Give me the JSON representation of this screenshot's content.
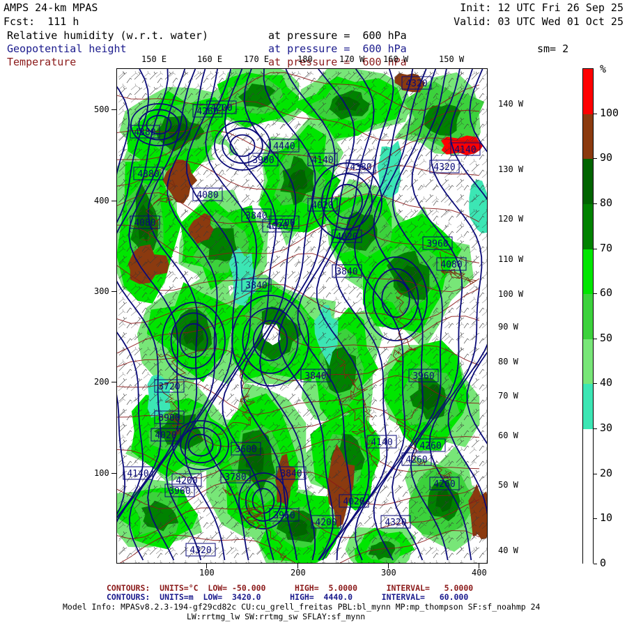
{
  "header": {
    "model_title": "AMPS 24-km MPAS",
    "init": "Init: 12 UTC Fri 26 Sep 25",
    "forecast": "Fcst:  111 h",
    "valid": "Valid: 03 UTC Wed 01 Oct 25",
    "smoothing": "sm= 2",
    "fields": [
      {
        "name": "Relative humidity (w.r.t. water)",
        "level": "at pressure =  600 hPa",
        "color": "#000000"
      },
      {
        "name": "Geopotential height",
        "level": "at pressure =  600 hPa",
        "color": "#1a1a8c"
      },
      {
        "name": "Temperature",
        "level": "at pressure =  600 hPa",
        "color": "#8b1a1a"
      }
    ]
  },
  "map": {
    "top_lon_labels": [
      "150 E",
      "160 E",
      "170 E",
      "180",
      "170 W",
      "160 W",
      "150 W"
    ],
    "right_lon_labels": [
      "140 W",
      "130 W",
      "120 W",
      "110 W",
      "100 W",
      "90 W",
      "80 W",
      "70 W",
      "60 W",
      "50 W",
      "40 W"
    ],
    "y_ticks": [
      "500",
      "400",
      "300",
      "200",
      "100"
    ],
    "x_ticks": [
      "100",
      "200",
      "300",
      "400"
    ],
    "height_contour_labels": [
      "4260",
      "4260",
      "4380",
      "4200",
      "4200",
      "4020",
      "4020",
      "4320",
      "4380",
      "4320",
      "4140",
      "3960",
      "4020",
      "4140",
      "3900",
      "3840",
      "4080",
      "3960",
      "3600",
      "3840",
      "3720",
      "3900",
      "3960",
      "4080",
      "4140",
      "4020",
      "3840",
      "3780",
      "3840",
      "4020",
      "4080",
      "3840",
      "4200",
      "4260",
      "4140",
      "3960",
      "4200",
      "4320",
      "4320",
      "4380",
      "4440",
      "4260"
    ],
    "colors": {
      "height": "#0a0a78",
      "temperature": "#8b1a1a",
      "barb": "#333333"
    }
  },
  "colorbar": {
    "unit": "%",
    "labels": [
      "100",
      "90",
      "80",
      "70",
      "60",
      "50",
      "40",
      "30",
      "20",
      "10",
      "0"
    ],
    "segments": [
      {
        "from": 100,
        "to": 110,
        "color": "#ff0000"
      },
      {
        "from": 90,
        "to": 100,
        "color": "#8b3a0f"
      },
      {
        "from": 80,
        "to": 90,
        "color": "#006400"
      },
      {
        "from": 70,
        "to": 80,
        "color": "#008200"
      },
      {
        "from": 60,
        "to": 70,
        "color": "#00e600"
      },
      {
        "from": 50,
        "to": 60,
        "color": "#3cd23c"
      },
      {
        "from": 40,
        "to": 50,
        "color": "#78e678"
      },
      {
        "from": 30,
        "to": 40,
        "color": "#3ce6b4"
      },
      {
        "from": 0,
        "to": 30,
        "color": "#ffffff"
      }
    ]
  },
  "footer": {
    "contours1": "CONTOURS:  UNITS=°C  LOW= -50.000      HIGH=  5.0000      INTERVAL=   5.0000",
    "contours2": "CONTOURS:  UNITS=m  LOW=  3420.0      HIGH=  4440.0      INTERVAL=   60.000",
    "model_info1": "Model Info: MPASv8.2.3-194-gf29cd82c CU:cu_grell_freitas PBL:bl_mynn MP:mp_thompson SF:sf_noahmp 24",
    "model_info2": "LW:rrtmg_lw SW:rrtmg_sw SFLAY:sf_mynn"
  }
}
